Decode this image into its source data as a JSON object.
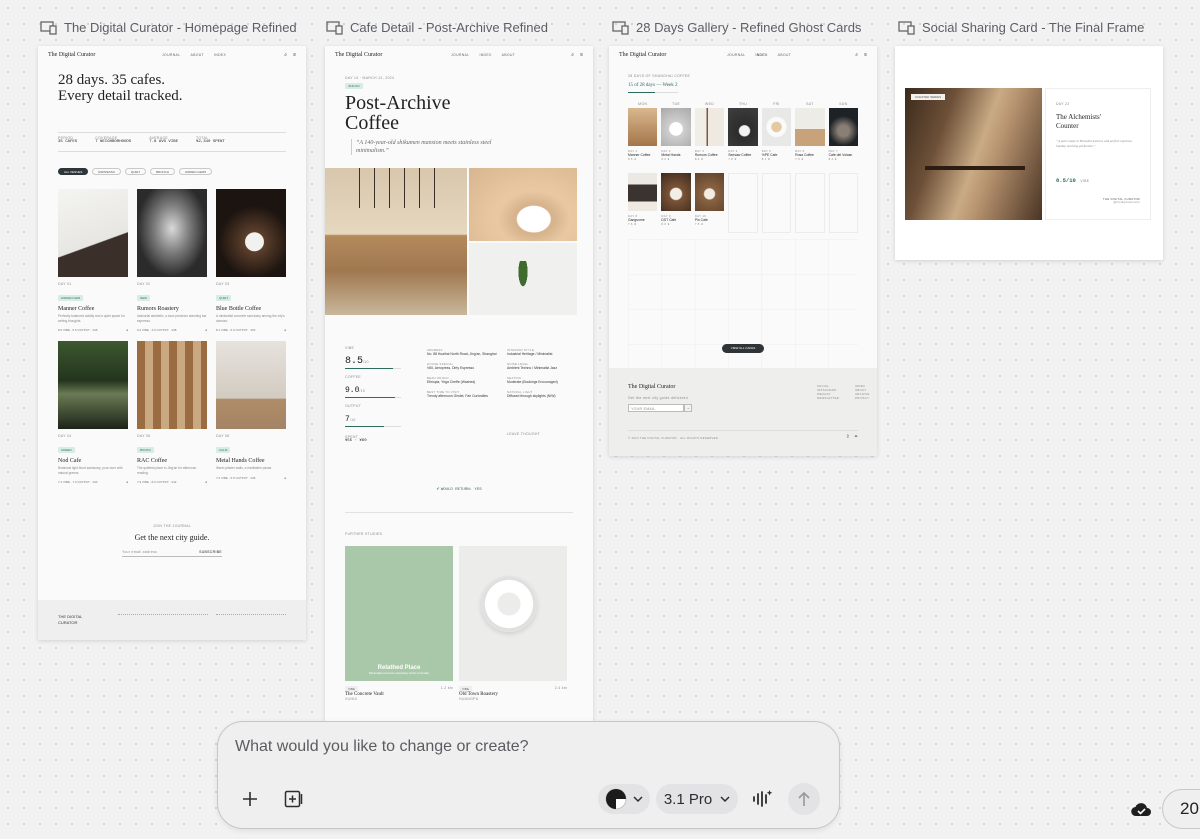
{
  "frames": [
    {
      "title": "The Digital Curator - Homepage Refined"
    },
    {
      "title": "Cafe Detail - Post-Archive Refined"
    },
    {
      "title": "28 Days Gallery - Refined Ghost Cards"
    },
    {
      "title": "Social Sharing Card - The Final Frame"
    }
  ],
  "home": {
    "brand": "The Digital Curator",
    "nav_links": [
      "JOURNAL",
      "ABOUT",
      "INDEX"
    ],
    "headline_line1": "28 days. 35 cafes.",
    "headline_line2": "Every detail tracked.",
    "stats": [
      {
        "label": "PERIOD",
        "value": "35 CAFES"
      },
      {
        "label": "COVERAGE",
        "value": "7 NEIGHBORHOODS"
      },
      {
        "label": "AVERAGE",
        "value": "7.8 AVG VIBE"
      },
      {
        "label": "TOTAL",
        "value": "¥2,340 SPENT"
      }
    ],
    "filters": [
      "ALL VENUES",
      "ESPRESSO",
      "QUIET",
      "BRUNCH",
      "HIDDEN GEMS"
    ],
    "cafes": [
      {
        "tag": "HIDDEN GEM",
        "name": "Manner Coffee",
        "desc": "Perfectly balanced acidity and a quiet space for writing thoughts.",
        "meta": "8.5 VIBE · 5.5 OUTPUT · ¥45"
      },
      {
        "tag": "NEW",
        "name": "Rumors Roastery",
        "desc": "Industrial aesthetic, a slow precision standing bar espresso.",
        "meta": "9.2 VIBE · 4.0 OUTPUT · ¥38"
      },
      {
        "tag": "QUIET",
        "name": "Blue Bottle Coffee",
        "desc": "A minimalist concrete sanctuary among the city's clamour.",
        "meta": "8.1 VIBE · 6.0 OUTPUT · ¥52"
      },
      {
        "tag": "GREEN",
        "name": "Nod Cafe",
        "desc": "Botanical light-flood sanctuary; pour-over with natural greens.",
        "meta": "7.4 VIBE · 7.0 OUTPUT · ¥40"
      },
      {
        "tag": "BOOKS",
        "name": "RAC Coffee",
        "desc": "The quietest place in Jing'an for afternoon reading.",
        "meta": "7.9 VIBE · 8.0 OUTPUT · ¥42"
      },
      {
        "tag": "CALM",
        "name": "Metal Hands Coffee",
        "desc": "Warm plaster walls, a meditative pause.",
        "meta": "7.6 VIBE · 6.5 OUTPUT · ¥36"
      }
    ],
    "newsletter_kicker": "JOIN THE JOURNAL",
    "newsletter_title": "Get the next city guide.",
    "newsletter_placeholder": "Your email address",
    "newsletter_submit": "SUBSCRIBE",
    "footer_brand_1": "THE DIGITAL",
    "footer_brand_2": "CURATOR"
  },
  "detail": {
    "brand": "The Digital Curator",
    "date": "DAY 14 · MARCH 12, 2024",
    "tag": "JING'AN",
    "title_line1": "Post-Archive",
    "title_line2": "Coffee",
    "quote": "“A 140-year-old shikumen mansion meets stainless steel minimalism.”",
    "scores": [
      {
        "label": "VIBE",
        "value": "8.5",
        "max": "/10",
        "level": 0.85
      },
      {
        "label": "COFFEE",
        "value": "9.0",
        "max": "/10",
        "level": 0.9
      },
      {
        "label": "OUTPUT",
        "value": "7",
        "max": "/10",
        "level": 0.7
      }
    ],
    "price_label": "SPENT",
    "price": "¥55 · ¥60",
    "facts": [
      {
        "k": "ADDRESS",
        "v": "No. 88 Huaihai North Road, Jing'an, Shanghai"
      },
      {
        "k": "INTERIOR STYLE",
        "v": "Industrial Heritage / Minimalist"
      },
      {
        "k": "HOUSE SPECIAL",
        "v": "V60, Aeropress, Dirty Espresso"
      },
      {
        "k": "NOISE LEVEL",
        "v": "Ambient Techno / Minimalist Jazz"
      },
      {
        "k": "BEAN ORIGIN",
        "v": "Ethiopia, Yirga Cheffe (Washed)"
      },
      {
        "k": "SEATING",
        "v": "Moderate (Bookings Encouraged)"
      },
      {
        "k": "BEST TIME TO VISIT",
        "v": "Trendy afternoon Gimlet, Fair Curiosities"
      },
      {
        "k": "NATURAL LIGHT",
        "v": "Diffused through skylights (N/W)"
      }
    ],
    "label_footer": "LEAVE THOUGHT",
    "would_return": "WOULD RETURN: YES",
    "further": "FURTHER STUDIES",
    "rec_overlay": "Relathed Place",
    "rec_overlay_sub": "Minimalist concrete sanctuary at the riverside",
    "recs": [
      {
        "tag": "VIBE",
        "name": "The Concrete Vault",
        "sub": "XUHUI",
        "dist": "1.2 km"
      },
      {
        "tag": "VIBE",
        "name": "Old Town Roastery",
        "sub": "HUANGPU",
        "dist": "2.4 km"
      }
    ]
  },
  "gallery": {
    "brand": "The Digital Curator",
    "nav_links": [
      "JOURNAL",
      "INDEX",
      "ABOUT"
    ],
    "kicker": "28 DAYS OF SHANGHAI COFFEE",
    "progress_text": "15 of 28 days — Week 2",
    "progress_level": 0.536,
    "day_labels": [
      "MON",
      "TUE",
      "WED",
      "THU",
      "FRI",
      "SAT",
      "SUN"
    ],
    "days": [
      {
        "day": "DAY 1",
        "name": "Manner Coffee",
        "meta": "8.5 ★"
      },
      {
        "day": "DAY 2",
        "name": "Metal Hands",
        "meta": "9.0 ★"
      },
      {
        "day": "DAY 3",
        "name": "Rumors Coffee",
        "meta": "8.2 ★"
      },
      {
        "day": "DAY 4",
        "name": "Seesaw Coffee",
        "meta": "7.8 ★"
      },
      {
        "day": "DAY 5",
        "name": "%PE Cafe",
        "meta": "8.1 ★"
      },
      {
        "day": "DAY 6",
        "name": "Rosa Coffee",
        "meta": "7.9 ★"
      },
      {
        "day": "DAY 7",
        "name": "Cafe del Volcan",
        "meta": "8.4 ★"
      },
      {
        "day": "DAY 8",
        "name": "Gangsome",
        "meta": "7.6 ★"
      },
      {
        "day": "DAY 9",
        "name": "DST Cafe",
        "meta": "8.0 ★"
      },
      {
        "day": "DAY 10",
        "name": "Pin Cafe",
        "meta": "7.5 ★"
      }
    ],
    "view_all": "VIEW ALL CAFES",
    "footer_brand": "The Digital Curator",
    "footer_tag": "Get the next city guide delivered",
    "footer_input": "YOUR EMAIL",
    "footer_cols": [
      "SOCIAL",
      "INDEX"
    ],
    "footer_links_a": [
      "INSTAGRAM",
      "WECHAT",
      "NEWSLETTER"
    ],
    "footer_links_b": [
      "ABOUT",
      "ARCHIVE",
      "PRIVACY"
    ],
    "copyright": "© 2024 THE DIGITAL CURATOR · ALL RIGHTS RESERVED"
  },
  "social": {
    "badge": "CURATED SERIES",
    "day": "DAY 22",
    "title_line1": "The Alchemists'",
    "title_line2": "Counter",
    "quote": "“A quiet study in Brutalist textures and perfect espresso. Sunday morning perfection.”",
    "score": "8.5/10",
    "score_label": "VIBE",
    "footer_brand": "THE DIGITAL CURATOR",
    "footer_sub": "@thedigitalcurator"
  },
  "prompt": {
    "placeholder": "What would you like to change or create?",
    "model": "3.1 Pro",
    "zoom_partial": "20"
  },
  "colors": {
    "accent": "#2f6b5d",
    "canvas": "#f2f2f3",
    "chip_dark": "#2e3438",
    "rec_green": "#a8c8a9"
  },
  "icons": [
    "device-frame-icon",
    "search-icon",
    "menu-icon",
    "plus-icon",
    "add-frame-icon",
    "theme-toggle-icon",
    "chevron-down-icon",
    "voice-sparkle-icon",
    "send-arrow-icon",
    "cloud-check-icon",
    "check-circle-icon"
  ]
}
